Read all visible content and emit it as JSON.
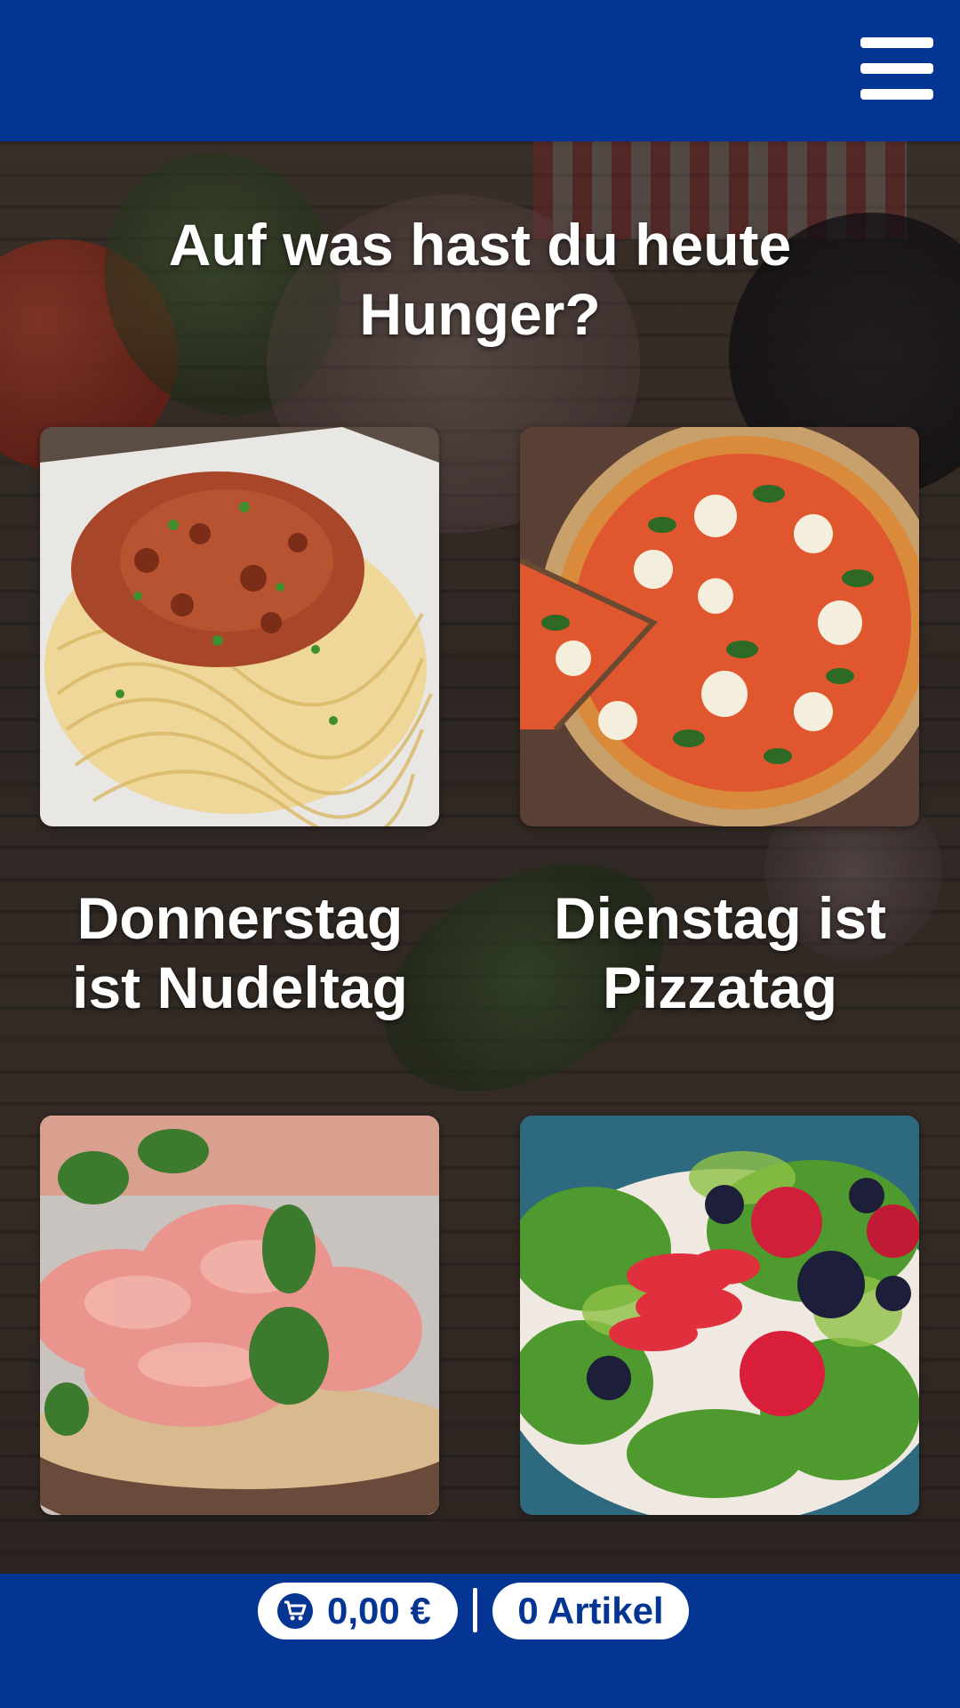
{
  "header": {
    "menu_icon": "hamburger-menu-icon",
    "background_color": "#053593"
  },
  "main": {
    "headline_line1": "Auf was hast du heute",
    "headline_line2": "Hunger?",
    "tiles": [
      {
        "name": "spaghetti-bolognese-image",
        "icon": "spaghetti-photo"
      },
      {
        "name": "pizza-margherita-image",
        "icon": "pizza-photo"
      },
      {
        "name": "prosciutto-image",
        "icon": "ham-photo"
      },
      {
        "name": "berry-salad-image",
        "icon": "salad-photo"
      }
    ],
    "captions": {
      "left_line1": "Donnerstag",
      "left_line2": "ist Nudeltag",
      "right_line1": "Dienstag ist",
      "right_line2": "Pizzatag"
    }
  },
  "footer": {
    "cart_icon": "shopping-cart-icon",
    "cart_amount": "0,00 €",
    "item_count": "0 Artikel",
    "background_color": "#053593"
  }
}
